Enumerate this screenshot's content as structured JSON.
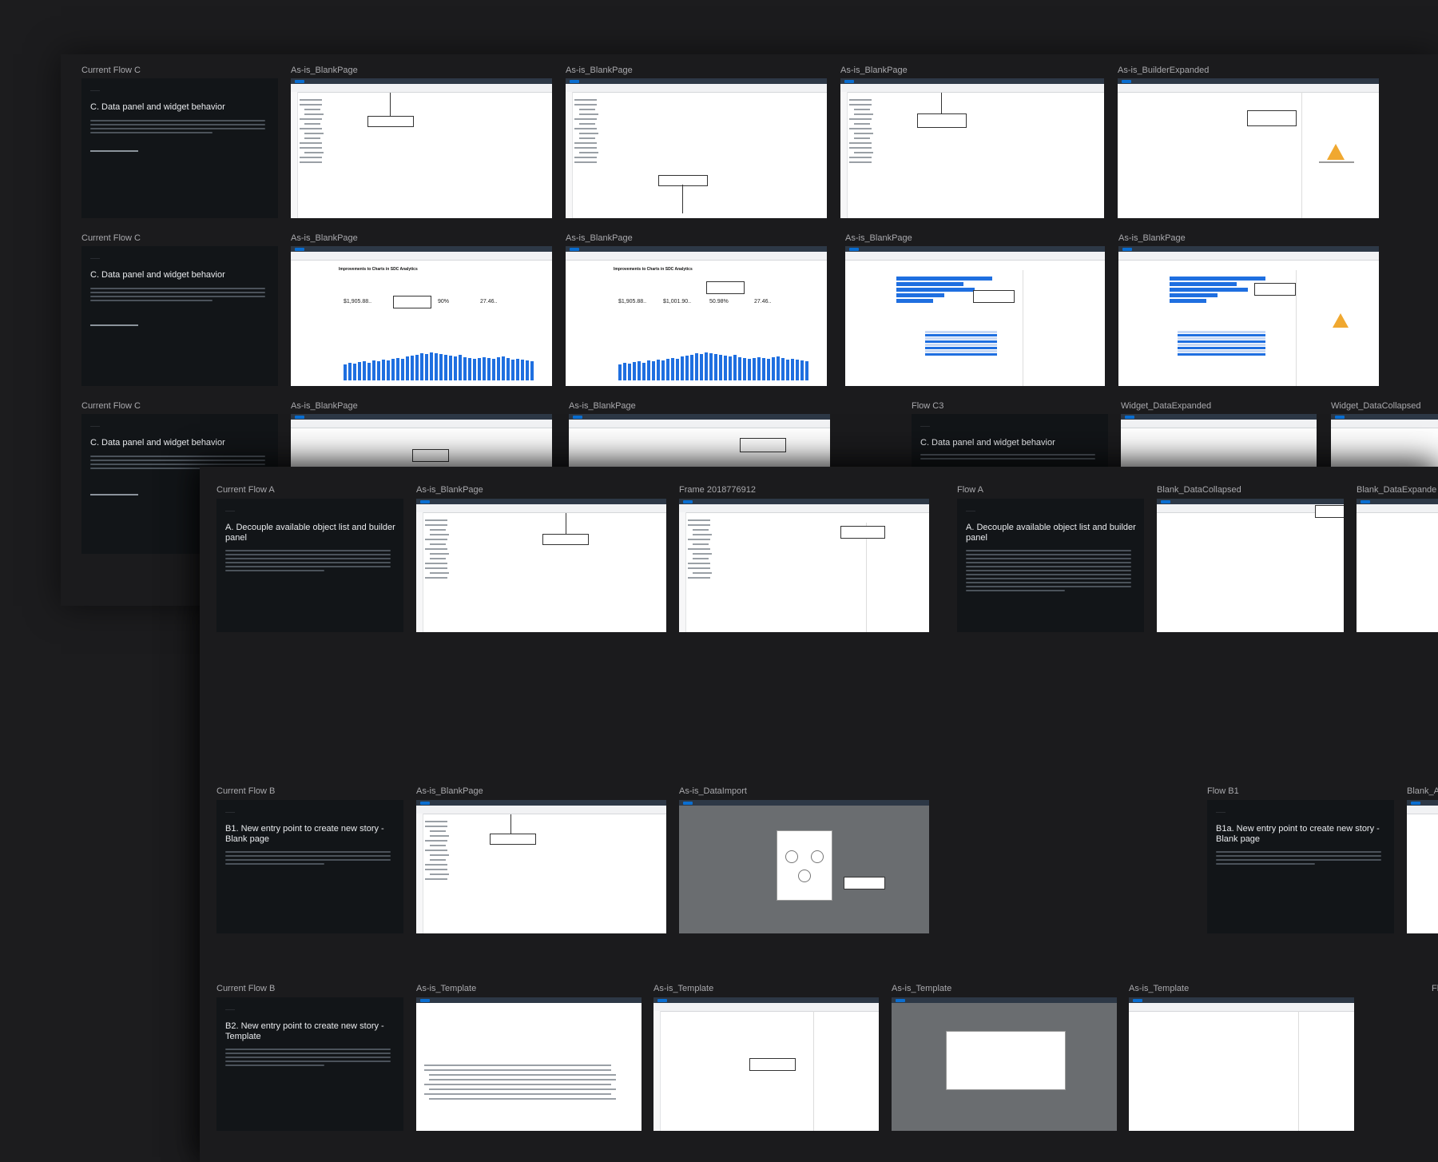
{
  "labels": {
    "r1c1": "Current Flow C",
    "r1c2": "As-is_BlankPage",
    "r1c3": "As-is_BlankPage",
    "r1c4": "As-is_BlankPage",
    "r1c5": "As-is_BuilderExpanded",
    "r2c1": "Current Flow C",
    "r2c2": "As-is_BlankPage",
    "r2c3": "As-is_BlankPage",
    "r2c4": "As-is_BlankPage",
    "r2c5": "As-is_BlankPage",
    "r3c1": "Current Flow C",
    "r3c2": "As-is_BlankPage",
    "r3c3": "As-is_BlankPage",
    "r3c4": "Flow C3",
    "r3c5": "Widget_DataExpanded",
    "r3c6": "Widget_DataCollapsed",
    "r4c1": "Current Flow A",
    "r4c2": "As-is_BlankPage",
    "r4c3": "Frame 2018776912",
    "r4c4": "Flow A",
    "r4c5": "Blank_DataCollapsed",
    "r4c6": "Blank_DataExpande",
    "r5c1": "Current Flow B",
    "r5c2": "As-is_BlankPage",
    "r5c3": "As-is_DataImport",
    "r5c4": "Flow B1",
    "r5c5": "Blank_A",
    "r6c1": "Current Flow B",
    "r6c2": "As-is_Template",
    "r6c3": "As-is_Template",
    "r6c4": "As-is_Template",
    "r6c5": "As-is_Template",
    "r6c6": "Fl"
  },
  "cards": {
    "c1": "C. Data panel and widget behavior",
    "c2": "C. Data panel and widget behavior",
    "c3": "C. Data panel and widget behavior",
    "c4": "C. Data panel and widget behavior",
    "a1": "A. Decouple available object list and builder panel",
    "a2": "A. Decouple available object list and builder panel",
    "b1": "B1. New entry point to create new story - Blank page",
    "b1a": "B1a. New entry point to create new story - Blank page",
    "b2": "B2. New entry point to create new story - Template"
  },
  "kpis": {
    "k1": "$1,905.88..",
    "k2": "90%",
    "k3": "27.46..",
    "k4": "$1,905.88..",
    "k5": "$1,001.90..",
    "k6": "50.98%",
    "k7": "27.46.."
  },
  "colors": {
    "canvas": "#1c1c1e",
    "panel": "#1b1b1d",
    "card": "#121518",
    "accent": "#1f6fe0",
    "shell": "#2d3846"
  }
}
